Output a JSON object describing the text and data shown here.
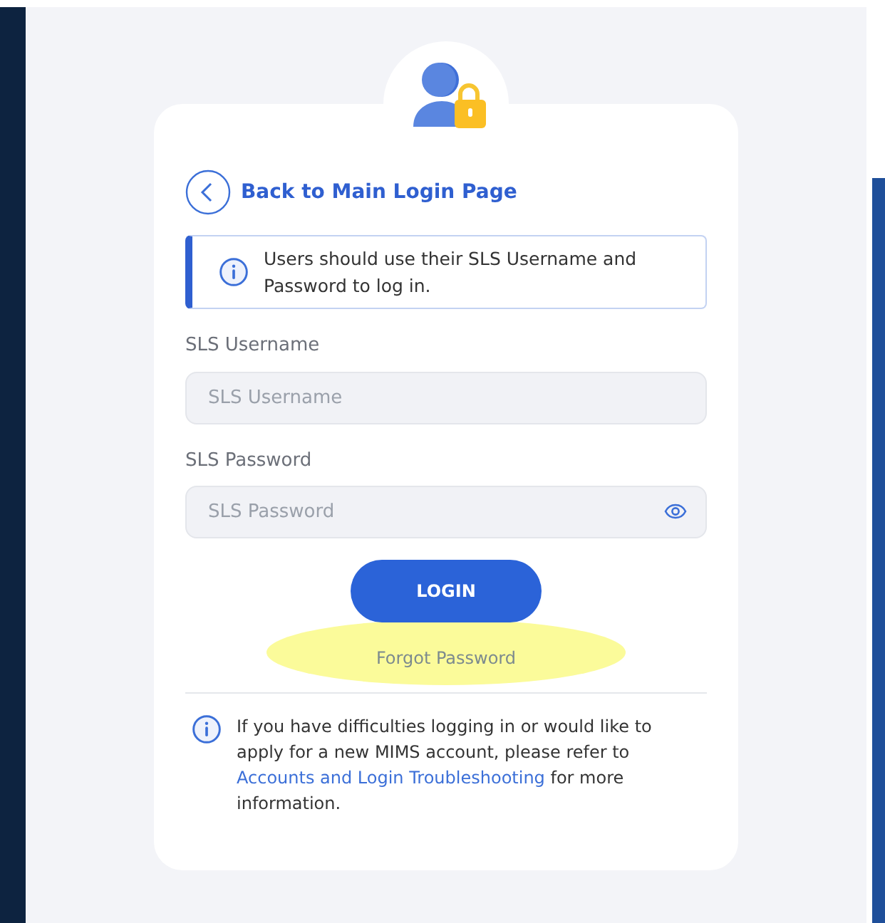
{
  "back_link": {
    "label": "Back to Main Login Page"
  },
  "notice": {
    "text": "Users should use their SLS Username and Password to log in."
  },
  "fields": [
    {
      "label": "SLS Username",
      "placeholder": "SLS Username",
      "kind": "text"
    },
    {
      "label": "SLS Password",
      "placeholder": "SLS Password",
      "kind": "password"
    }
  ],
  "login_button": {
    "label": "LOGIN"
  },
  "forgot_password": {
    "label": "Forgot Password",
    "highlighted": true
  },
  "help": {
    "before": "If you have difficulties logging in or would like to apply for a new MIMS account, please refer to ",
    "link": "Accounts and Login Troubleshooting",
    "after": " for more information."
  }
}
